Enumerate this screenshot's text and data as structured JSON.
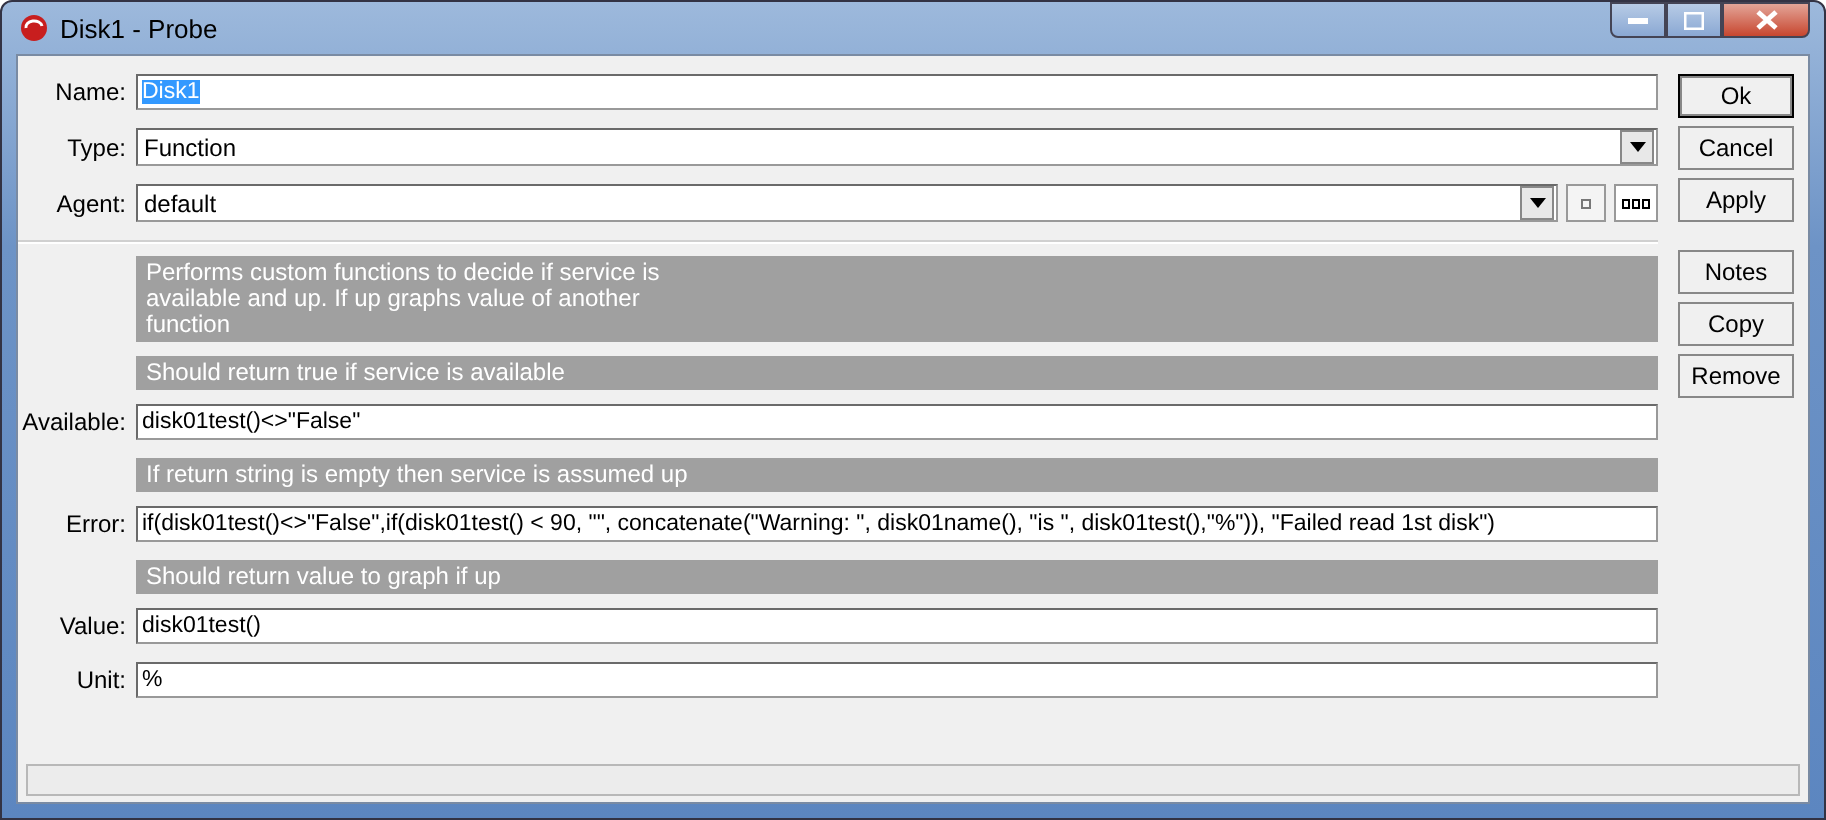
{
  "window": {
    "title": "Disk1 - Probe"
  },
  "header_fields": [
    {
      "kind": "text",
      "label": "Name:",
      "value": "Disk1",
      "text_selected": true
    },
    {
      "kind": "dropdown",
      "label": "Type:",
      "value": "Function"
    },
    {
      "kind": "dropdown_picker",
      "label": "Agent:",
      "value": "default"
    }
  ],
  "rows": [
    {
      "kind": "note",
      "text": "Performs custom functions to decide if service is\navailable and up. If up graphs value of another\nfunction"
    },
    {
      "kind": "note",
      "text": "Should return true if service is available"
    },
    {
      "kind": "text",
      "label": "Available:",
      "value": "disk01test()<>\"False\""
    },
    {
      "kind": "note",
      "text": "If return string is empty then service is assumed up"
    },
    {
      "kind": "text",
      "label": "Error:",
      "value": "if(disk01test()<>\"False\",if(disk01test() < 90, \"\", concatenate(\"Warning: \", disk01name(), \"is \", disk01test(),\"%\")), \"Failed read 1st disk\")"
    },
    {
      "kind": "note",
      "text": "Should return value to graph if up"
    },
    {
      "kind": "text",
      "label": "Value:",
      "value": "disk01test()"
    },
    {
      "kind": "text",
      "label": "Unit:",
      "value": "%"
    }
  ],
  "buttons_top": [
    {
      "label": "Ok",
      "default": true
    },
    {
      "label": "Cancel",
      "default": false
    },
    {
      "label": "Apply",
      "default": false
    }
  ],
  "buttons_bottom": [
    {
      "label": "Notes",
      "default": false
    },
    {
      "label": "Copy",
      "default": false
    },
    {
      "label": "Remove",
      "default": false
    }
  ]
}
